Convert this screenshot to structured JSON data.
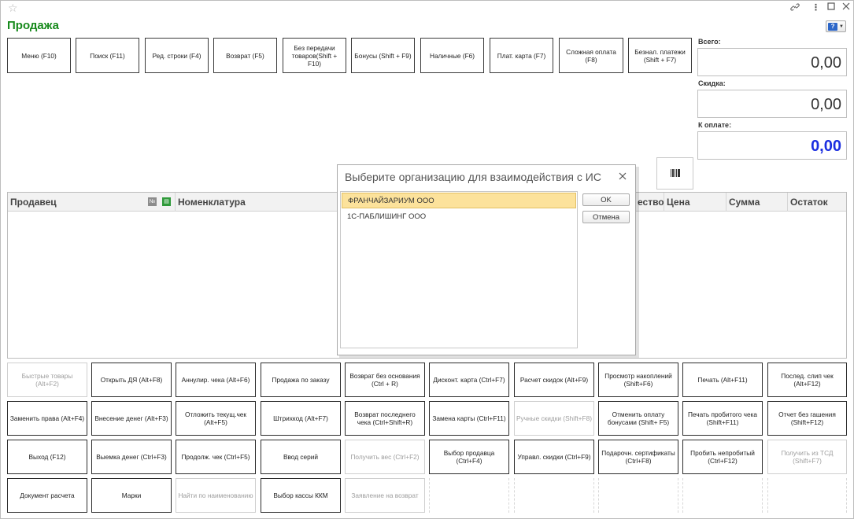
{
  "window": {
    "title": "Продажа",
    "help_label": "?"
  },
  "top_buttons": [
    {
      "label": "Меню (F10)",
      "enabled": true
    },
    {
      "label": "Поиск (F11)",
      "enabled": true
    },
    {
      "label": "Ред. строки (F4)",
      "enabled": true
    },
    {
      "label": "Возврат (F5)",
      "enabled": true
    },
    {
      "label": "Без передачи товаров(Shift + F10)",
      "enabled": true
    },
    {
      "label": "Бонусы (Shift + F9)",
      "enabled": true
    },
    {
      "label": "Наличные (F6)",
      "enabled": true
    },
    {
      "label": "Плат. карта (F7)",
      "enabled": true
    },
    {
      "label": "Сложная оплата (F8)",
      "enabled": true
    },
    {
      "label": "Безнал. платежи (Shift + F7)",
      "enabled": true
    }
  ],
  "totals": {
    "total_label": "Всего:",
    "total_value": "0,00",
    "discount_label": "Скидка:",
    "discount_value": "0,00",
    "to_pay_label": "К оплате:",
    "to_pay_value": "0,00"
  },
  "table": {
    "columns": {
      "seller": "Продавец",
      "nomenclature": "Номенклатура",
      "quantity": "ество",
      "price": "Цена",
      "sum": "Сумма",
      "remainder": "Остаток"
    },
    "num_icon": "№",
    "rows": []
  },
  "bottom_buttons": [
    [
      {
        "label": "Быстрые товары (Alt+F2)",
        "enabled": false
      },
      {
        "label": "Открыть ДЯ (Alt+F8)",
        "enabled": true
      },
      {
        "label": "Аннулир. чека (Alt+F6)",
        "enabled": true
      },
      {
        "label": "Продажа по заказу",
        "enabled": true
      },
      {
        "label": "Возврат без основания (Ctrl + R)",
        "enabled": true
      },
      {
        "label": "Дисконт. карта (Ctrl+F7)",
        "enabled": true
      },
      {
        "label": "Расчет скидок (Alt+F9)",
        "enabled": true
      },
      {
        "label": "Просмотр накоплений (Shift+F6)",
        "enabled": true
      },
      {
        "label": "Печать (Alt+F11)",
        "enabled": true
      },
      {
        "label": "Послед. слип чек (Alt+F12)",
        "enabled": true
      }
    ],
    [
      {
        "label": "Заменить права (Alt+F4)",
        "enabled": true
      },
      {
        "label": "Внесение денег (Alt+F3)",
        "enabled": true
      },
      {
        "label": "Отложить текущ.чек (Alt+F5)",
        "enabled": true
      },
      {
        "label": "Штрихкод (Alt+F7)",
        "enabled": true
      },
      {
        "label": "Возврат последнего чека (Ctrl+Shift+R)",
        "enabled": true
      },
      {
        "label": "Замена карты (Ctrl+F11)",
        "enabled": true
      },
      {
        "label": "Ручные скидки (Shift+F8)",
        "enabled": false
      },
      {
        "label": "Отменить оплату бонусами (Shift+ F5)",
        "enabled": true
      },
      {
        "label": "Печать пробитого чека (Shift+F11)",
        "enabled": true
      },
      {
        "label": "Отчет без гашения (Shift+F12)",
        "enabled": true
      }
    ],
    [
      {
        "label": "Выход (F12)",
        "enabled": true
      },
      {
        "label": "Выемка денег (Ctrl+F3)",
        "enabled": true
      },
      {
        "label": "Продолж. чек (Ctrl+F5)",
        "enabled": true
      },
      {
        "label": "Ввод серий",
        "enabled": true
      },
      {
        "label": "Получить вес (Ctrl+F2)",
        "enabled": false
      },
      {
        "label": "Выбор продавца (Ctrl+F4)",
        "enabled": true
      },
      {
        "label": "Управл. скидки (Ctrl+F9)",
        "enabled": true
      },
      {
        "label": "Подарочн. сертификаты (Ctrl+F8)",
        "enabled": true
      },
      {
        "label": "Пробить непробитый (Ctrl+F12)",
        "enabled": true
      },
      {
        "label": "Получить из ТСД (Shift+F7)",
        "enabled": false
      }
    ],
    [
      {
        "label": "Документ расчета",
        "enabled": true
      },
      {
        "label": "Марки",
        "enabled": true
      },
      {
        "label": "Найти по наименованию",
        "enabled": false
      },
      {
        "label": "Выбор кассы ККМ",
        "enabled": true
      },
      {
        "label": "Заявление на возврат",
        "enabled": false
      }
    ]
  ],
  "dialog": {
    "title": "Выберите организацию для взаимодействия с ИС",
    "organizations": [
      {
        "name": "ФРАНЧАЙЗАРИУМ ООО",
        "selected": true
      },
      {
        "name": "1С-ПАБЛИШИНГ ООО",
        "selected": false
      }
    ],
    "ok_label": "OK",
    "cancel_label": "Отмена"
  },
  "colors": {
    "title_green": "#178a1c",
    "to_pay_blue": "#1b2ee0",
    "selection_yellow": "#fce29b"
  }
}
